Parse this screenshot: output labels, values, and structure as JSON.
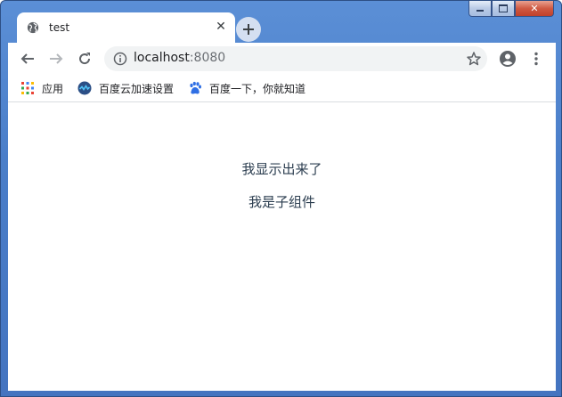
{
  "window": {
    "controls": [
      "minimize",
      "maximize",
      "close"
    ]
  },
  "tab": {
    "title": "test",
    "favicon": "globe-icon",
    "close_glyph": "✕"
  },
  "new_tab_glyph": "+",
  "address_bar": {
    "host": "localhost",
    "port": ":8080"
  },
  "bookmarks": [
    {
      "label": "应用",
      "icon": "apps-grid-icon"
    },
    {
      "label": "百度云加速设置",
      "icon": "baidu-cloud-icon"
    },
    {
      "label": "百度一下，你就知道",
      "icon": "baidu-paw-icon"
    }
  ],
  "page": {
    "line1": "我显示出来了",
    "line2": "我是子组件"
  },
  "colors": {
    "accent": "#4474c0",
    "text": "#2c3e50"
  }
}
